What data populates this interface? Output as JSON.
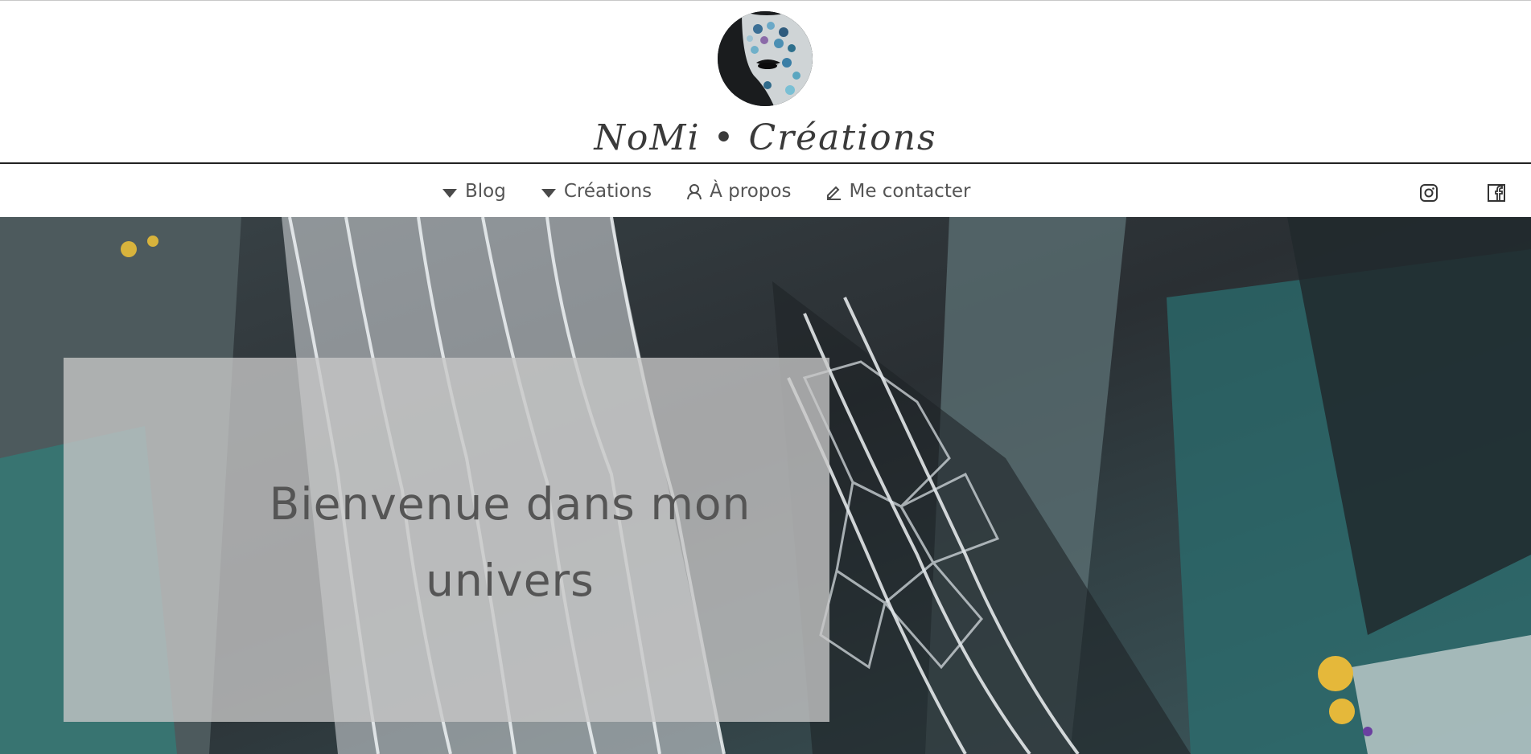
{
  "header": {
    "site_title": "NoMi • Créations",
    "logo": "painted-face-logo"
  },
  "nav": {
    "items": [
      {
        "label": "Blog",
        "icon": "caret-down-icon"
      },
      {
        "label": "Créations",
        "icon": "caret-down-icon"
      },
      {
        "label": "À propos",
        "icon": "user-icon"
      },
      {
        "label": "Me contacter",
        "icon": "pencil-icon"
      }
    ],
    "social": [
      {
        "name": "instagram-icon"
      },
      {
        "name": "facebook-icon"
      }
    ]
  },
  "hero": {
    "title_line1": "Bienvenue dans mon",
    "title_line2": "univers",
    "background": "abstract-painting",
    "panel_color": "#c8c8c8"
  },
  "colors": {
    "text": "#4a4a4a",
    "rule": "#222222",
    "painting_dark": "#2a3338",
    "painting_teal": "#2f7f7a"
  }
}
